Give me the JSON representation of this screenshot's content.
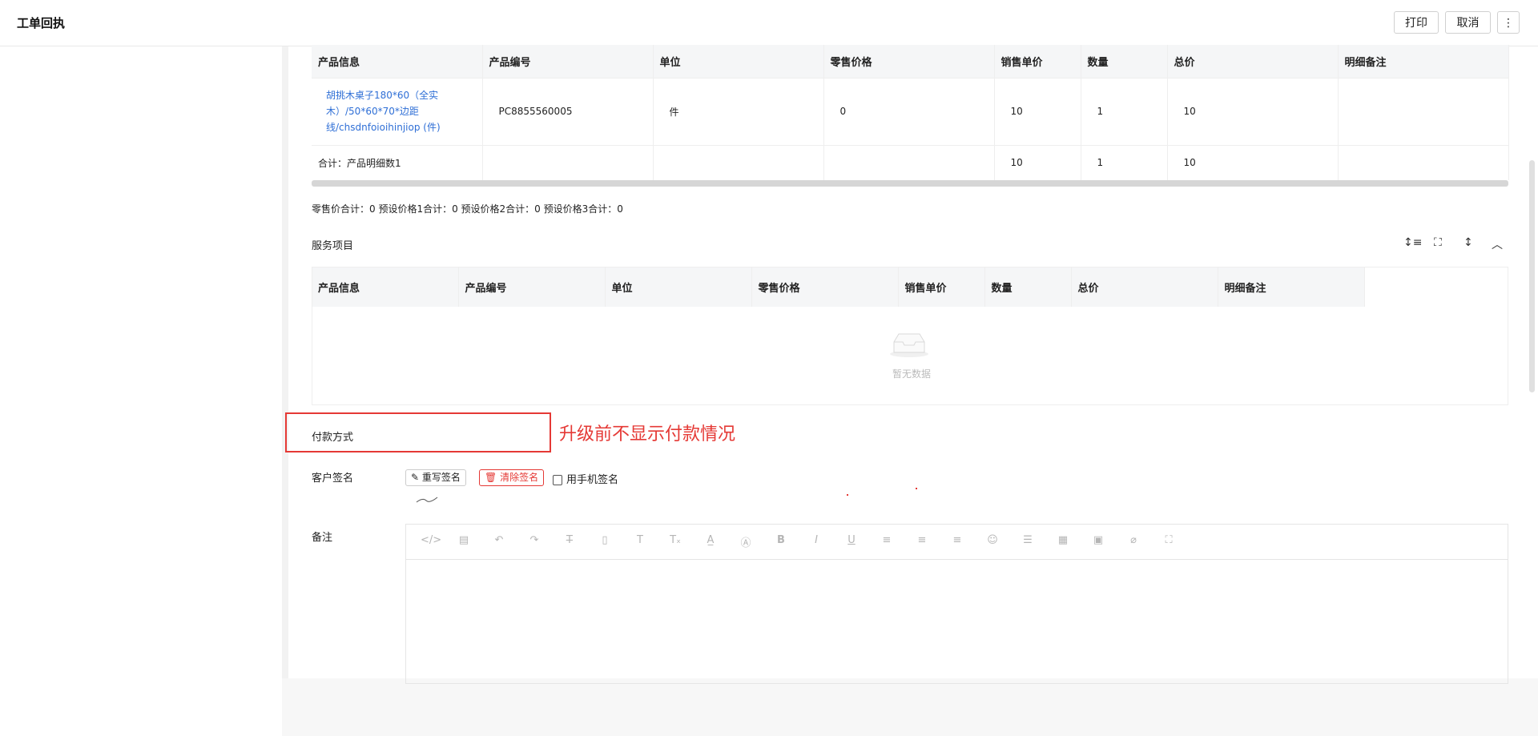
{
  "header": {
    "title": "工单回执",
    "print_label": "打印",
    "cancel_label": "取消",
    "more_label": "⋮"
  },
  "product_table": {
    "columns": [
      "产品信息",
      "产品编号",
      "单位",
      "零售价格",
      "销售单价",
      "数量",
      "总价",
      "明细备注"
    ],
    "rows": [
      {
        "product_info": "胡挑木桌子180*60（全实木）/50*60*70*边距线/chsdnfoioihinjiop (件)",
        "product_info_line1": "胡挑木桌子180*60（全实",
        "product_info_line2": "木）/50*60*70*边距",
        "product_info_line3": "线/chsdnfoioihinjiop (件)",
        "code": "PC8855560005",
        "unit": "件",
        "retail_price": "0",
        "sale_price": "10",
        "quantity": "1",
        "total": "10",
        "remark": ""
      }
    ],
    "total_row": {
      "label": "合计：产品明细数1",
      "sale_price": "10",
      "quantity": "1",
      "total": "10"
    }
  },
  "summary_text": "零售价合计：0  预设价格1合计：0  预设价格2合计：0  预设价格3合计：0",
  "service_section": {
    "title": "服务项目",
    "columns": [
      "产品信息",
      "产品编号",
      "单位",
      "零售价格",
      "销售单价",
      "数量",
      "总价",
      "明细备注"
    ],
    "empty_text": "暂无数据"
  },
  "payment": {
    "label": "付款方式",
    "annotation": "升级前不显示付款情况"
  },
  "signature": {
    "label": "客户签名",
    "rewrite_label": "重写签名",
    "clear_label": "清除签名",
    "mobile_label": "用手机签名"
  },
  "remark": {
    "label": "备注"
  },
  "colors": {
    "link": "#2f6fd6",
    "danger": "#e53935",
    "header_bg": "#f5f6f7"
  }
}
